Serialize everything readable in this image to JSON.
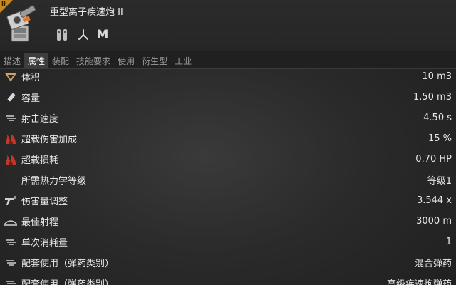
{
  "header": {
    "title": "重型离子疾速炮 II",
    "corner_mark": "II",
    "traits": [
      {
        "icon": "turret-hardpoint-icon"
      },
      {
        "icon": "tri-blade-icon"
      },
      {
        "label": "M",
        "icon": "size-medium-icon"
      }
    ]
  },
  "tabs": [
    {
      "label": "描述"
    },
    {
      "label": "属性",
      "active": true
    },
    {
      "label": "装配"
    },
    {
      "label": "技能要求"
    },
    {
      "label": "使用"
    },
    {
      "label": "衍生型"
    },
    {
      "label": "工业"
    }
  ],
  "attributes": [
    {
      "icon": "volume-icon",
      "label": "体积",
      "value": "10 m3"
    },
    {
      "icon": "capacity-icon",
      "label": "容量",
      "value": "1.50 m3"
    },
    {
      "icon": "rate-of-fire-icon",
      "label": "射击速度",
      "value": "4.50 s"
    },
    {
      "icon": "overload-flame-icon",
      "label": "超载伤害加成",
      "value": "15 %"
    },
    {
      "icon": "overload-flame-icon",
      "label": "超载损耗",
      "value": "0.70 HP"
    },
    {
      "icon": "",
      "label": "所需热力学等级",
      "value": "等级1"
    },
    {
      "icon": "damage-modifier-icon",
      "label": "伤害量调整",
      "value": "3.544 x"
    },
    {
      "icon": "optimal-range-icon",
      "label": "最佳射程",
      "value": "3000 m"
    },
    {
      "icon": "consumption-icon",
      "label": "单次消耗量",
      "value": "1"
    },
    {
      "icon": "charge-group-icon",
      "label": "配套使用（弹药类别）",
      "value": "混合弹药"
    },
    {
      "icon": "charge-group-icon",
      "label": "配套使用（弹药类别）",
      "value": "高级疾速炮弹药"
    }
  ],
  "colors": {
    "background": "#2a2a2a",
    "tab_active": "#3d3d3d",
    "corner_badge": "#c8891e",
    "overload_red": "#c0392b",
    "text": "#e6e6e6"
  }
}
